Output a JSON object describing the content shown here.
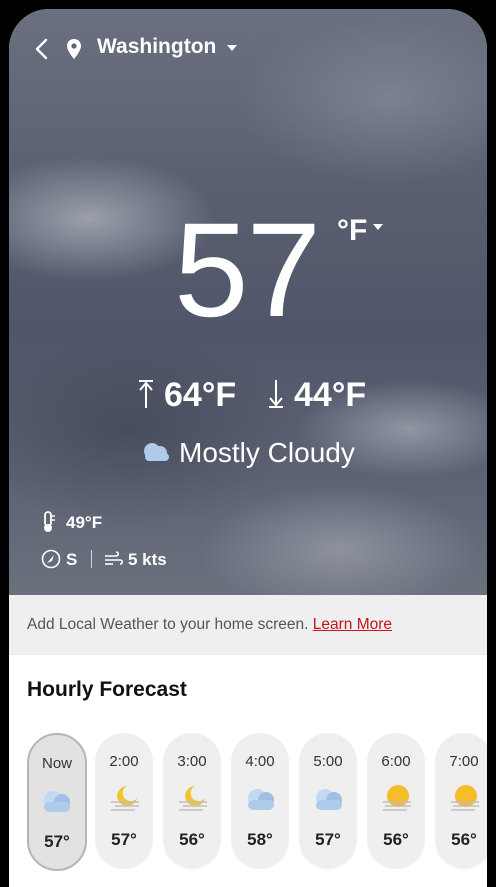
{
  "header": {
    "location": "Washington"
  },
  "current": {
    "temperature": "57",
    "unit": "°F",
    "high": "64°F",
    "low": "44°F",
    "condition": "Mostly Cloudy",
    "feels_like": "49°F",
    "wind_direction": "S",
    "wind_speed": "5 kts"
  },
  "banner": {
    "text": "Add Local Weather to your home screen. ",
    "link": "Learn More"
  },
  "hourly": {
    "title": "Hourly Forecast",
    "items": [
      {
        "time": "Now",
        "icon": "cloud-icon",
        "temp": "57°"
      },
      {
        "time": "2:00",
        "icon": "moon-haze-icon",
        "temp": "57°"
      },
      {
        "time": "3:00",
        "icon": "moon-haze-icon",
        "temp": "56°"
      },
      {
        "time": "4:00",
        "icon": "cloud-icon",
        "temp": "58°"
      },
      {
        "time": "5:00",
        "icon": "cloud-icon",
        "temp": "57°"
      },
      {
        "time": "6:00",
        "icon": "sun-haze-icon",
        "temp": "56°"
      },
      {
        "time": "7:00",
        "icon": "sun-haze-icon",
        "temp": "56°"
      }
    ]
  },
  "colors": {
    "link": "#c8141c",
    "cloud": "#aecbea",
    "moon": "#f2c530",
    "sun": "#f5bd2a"
  }
}
